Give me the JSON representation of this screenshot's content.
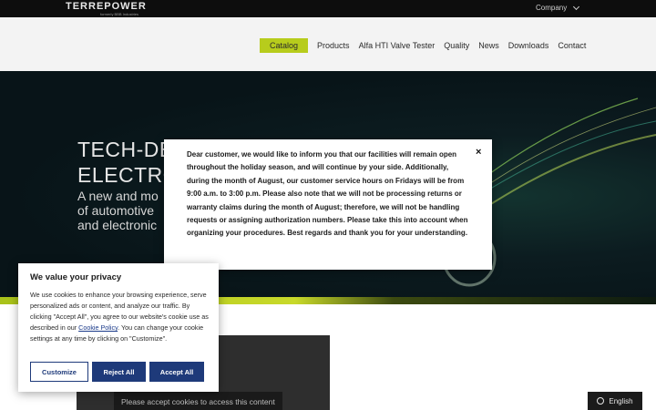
{
  "topbar": {
    "logo_text": "TERREPOWER",
    "logo_sub": "formerly BBB Industries",
    "company_label": "Company"
  },
  "nav": {
    "items": [
      "Catalog",
      "Products",
      "Alfa HTI Valve Tester",
      "Quality",
      "News",
      "Downloads",
      "Contact"
    ],
    "active_color": "#b7cc1c"
  },
  "hero": {
    "title_line1": "TECH-DE",
    "title_line2": "ELECTRO",
    "sub_line1": "A new and mo",
    "sub_line2": "of automotive",
    "sub_line3": "and electronic"
  },
  "notice": {
    "text": "Dear customer, we would like to inform you that our facilities will remain open throughout the holiday season, and will continue by your side. Additionally, during the month of August, our customer service hours on Fridays will be from 9:00 a.m. to 3:00 p.m. Please also note that we will not be processing returns or warranty claims during the month of August; therefore, we will not be handling requests or assigning authorization numbers. Please take this into account when organizing your procedures. Best regards and thank you for your understanding.",
    "close_symbol": "×"
  },
  "cookie": {
    "title": "We value your privacy",
    "body_before_link": "We use cookies to enhance your browsing experience, serve personalized ads or content, and analyze our traffic. By clicking \"Accept All\", you agree to our website's cookie use as described in our ",
    "link_text": "Cookie Policy",
    "body_after_link": ". You can change your cookie settings at any time by clicking on \"Customize\".",
    "customize_label": "Customize",
    "reject_label": "Reject All",
    "accept_label": "Accept All",
    "brand_color": "#1e3a7a"
  },
  "content": {
    "placeholder_message": "Please accept cookies to access this content"
  },
  "language": {
    "label": "English",
    "icon": "globe-icon"
  }
}
